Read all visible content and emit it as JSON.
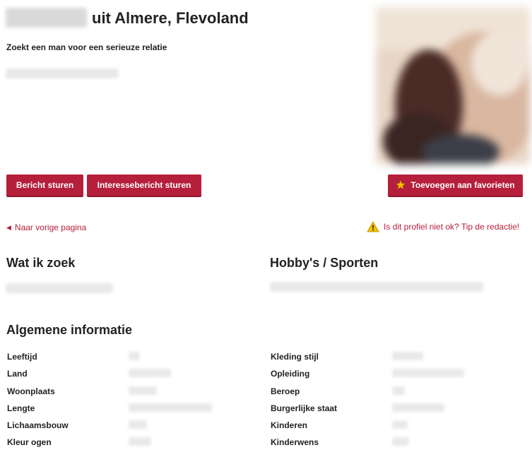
{
  "profile": {
    "title_suffix": "uit Almere, Flevoland",
    "tagline": "Zoekt een man voor een serieuze relatie"
  },
  "actions": {
    "send_message": "Bericht sturen",
    "send_interest": "Interessebericht sturen",
    "add_favorite": "Toevoegen aan favorieten"
  },
  "nav": {
    "back_link": "Naar vorige pagina",
    "report_link": "Is dit profiel niet ok? Tip de redactie!"
  },
  "sections": {
    "looking_for": "Wat ik zoek",
    "hobbies": "Hobby's / Sporten",
    "general": "Algemene informatie"
  },
  "info_left": [
    "Leeftijd",
    "Land",
    "Woonplaats",
    "Lengte",
    "Lichaamsbouw",
    "Kleur ogen"
  ],
  "info_right": [
    "Kleding stijl",
    "Opleiding",
    "Beroep",
    "Burgerlijke staat",
    "Kinderen",
    "Kinderwens"
  ],
  "colors": {
    "accent": "#b51f3c",
    "warning": "#f2c100"
  },
  "icons": {
    "back": "chevron-left-icon",
    "warning": "warning-icon",
    "favorite": "star-icon"
  }
}
